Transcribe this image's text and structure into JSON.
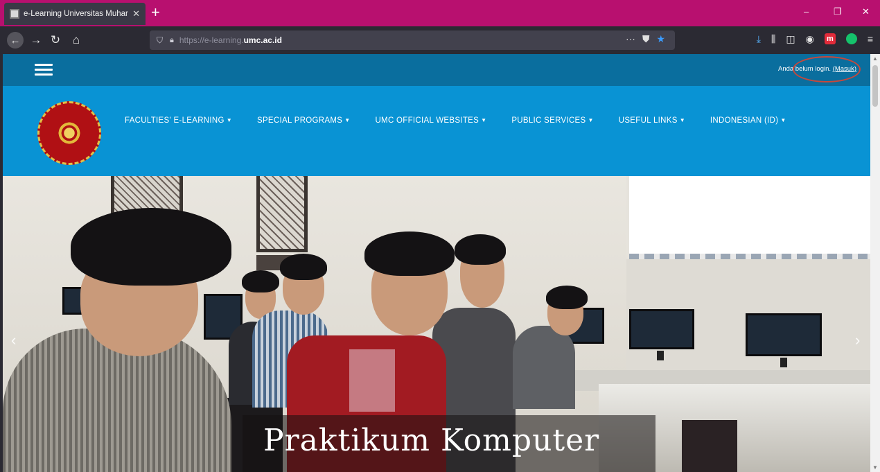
{
  "browser": {
    "tab_title": "e-Learning Universitas Muhan",
    "tab_close": "✕",
    "new_tab": "+",
    "url_prefix": "https://e-learning.",
    "url_domain": "umc.ac.id",
    "url_more": "···",
    "window_minimize": "–",
    "window_restore": "❐",
    "window_close": "✕"
  },
  "header": {
    "login_text": "Anda belum login.",
    "login_link": "(Masuk)"
  },
  "nav": {
    "items": [
      {
        "label": "FACULTIES' E-LEARNING"
      },
      {
        "label": "SPECIAL PROGRAMS"
      },
      {
        "label": "UMC OFFICIAL WEBSITES"
      },
      {
        "label": "PUBLIC SERVICES"
      },
      {
        "label": "USEFUL LINKS"
      },
      {
        "label": "INDONESIAN (ID)"
      }
    ],
    "caret": "▼"
  },
  "slider": {
    "caption": "Praktikum Komputer",
    "prev": "‹",
    "next": "›"
  },
  "colors": {
    "tabbar": "#b8106f",
    "top_strip": "#0a6e9e",
    "main_nav": "#0993d4",
    "highlight_circle": "#c9473a"
  }
}
